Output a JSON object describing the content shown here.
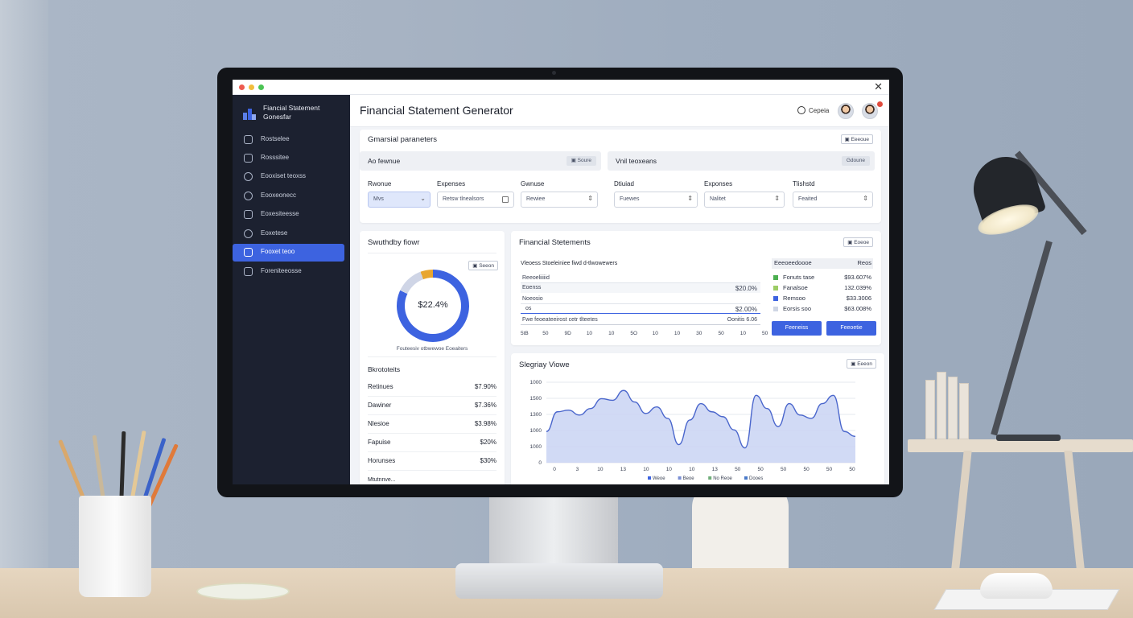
{
  "window": {
    "close_glyph": "✕"
  },
  "sidebar": {
    "brand": "Fiancial Statement Gonesfar",
    "items": [
      {
        "label": "Rostselee",
        "icon": "home-icon"
      },
      {
        "label": "Rosssitee",
        "icon": "calendar-icon"
      },
      {
        "label": "Eooxiset teoxss",
        "icon": "settings-icon"
      },
      {
        "label": "Eooxeonecc",
        "icon": "target-icon"
      },
      {
        "label": "Eoxesiteesse",
        "icon": "document-icon"
      },
      {
        "label": "Eoxetese",
        "icon": "globe-icon"
      },
      {
        "label": "Fooxet teoo",
        "icon": "user-icon",
        "active": true
      },
      {
        "label": "Foreniteeosse",
        "icon": "person-icon"
      }
    ]
  },
  "header": {
    "title": "Financial Statement Generator",
    "search_label": "Cepeia"
  },
  "params": {
    "title": "Gmarsial paraneters",
    "button": "Eeeoue",
    "left_bar": {
      "label": "Ao fewnue",
      "chip": "Soure"
    },
    "right_bar": {
      "label": "Vnil teoxeans",
      "chip": "Gdoune"
    },
    "fields": [
      {
        "label": "Rwonue",
        "value": "Mvs",
        "control": "chevron"
      },
      {
        "label": "Expenses",
        "value": "Retsw tlnealsors",
        "control": "checkbox"
      },
      {
        "label": "Gwnuse",
        "value": "Rewiee",
        "control": "stepper"
      },
      {
        "label": "Dtiuiad",
        "value": "Fuewes",
        "control": "stepper"
      },
      {
        "label": "Exponses",
        "value": "Nalitet",
        "control": "stepper"
      },
      {
        "label": "Tlishstd",
        "value": "Feaited",
        "control": "stepper"
      }
    ]
  },
  "donut_card": {
    "title": "Swuthdby fiowr",
    "button": "Seeon",
    "center_value": "$22.4%",
    "caption": "Fouteesiv otbwewoe Eoeaiters",
    "chart_data": {
      "type": "pie",
      "center_label": "$22.4%",
      "colors": [
        "#3d63e0",
        "#cfd5e6",
        "#e8a630"
      ]
    }
  },
  "breakdown": {
    "title": "Bkrototeits",
    "rows": [
      {
        "label": "Retinues",
        "value": "$7.90%"
      },
      {
        "label": "Dawiner",
        "value": "$7.36%"
      },
      {
        "label": "Nlesioe",
        "value": "$3.98%"
      },
      {
        "label": "Fapuise",
        "value": "$20%"
      },
      {
        "label": "Horunses",
        "value": "$30%"
      }
    ],
    "footer": "Mtutnnve..."
  },
  "statements": {
    "title": "Financial Stetements",
    "button": "Eoeoe",
    "table_title": "Vleoess Stoeleiniee fiwd d-tlwowewers",
    "lines": [
      {
        "label": "Reeoeliiiiid",
        "value": ""
      },
      {
        "label": "Eoenss",
        "value": "$20.0%"
      },
      {
        "label": "Noeosio",
        "value": ""
      },
      {
        "label": "os",
        "value": "$2.00%"
      },
      {
        "label": "Fwe feoeateeirost cetr tlteetes",
        "value": "Oonitis 6.06"
      }
    ],
    "axis_ticks": [
      "5tB",
      "50",
      "9D",
      "10",
      "10",
      "5O",
      "10",
      "10",
      "30",
      "50",
      "10",
      "50"
    ],
    "legend_header": {
      "name": "Eeeoeedoooe",
      "value": "Reos"
    },
    "legend": [
      {
        "name": "Fonuts tase",
        "value": "$93.607%",
        "color": "#4caf50"
      },
      {
        "name": "Fanalsoe",
        "value": "132.039%",
        "color": "#9ccc65"
      },
      {
        "name": "Remsoo",
        "value": "$33.3006",
        "color": "#3d63e0"
      },
      {
        "name": "Eorsis soo",
        "value": "$63.008%",
        "color": "#cfd6e4"
      }
    ],
    "buttons": [
      "Feeneiss",
      "Feeoetie"
    ]
  },
  "summary": {
    "title": "Slegriay Viowe",
    "button": "Eeeon",
    "chart_data": {
      "type": "area",
      "y_ticks": [
        "1000",
        "1500",
        "1300",
        "1000",
        "1000",
        "0"
      ],
      "x_ticks": [
        "0",
        "3",
        "10",
        "13",
        "10",
        "10",
        "10",
        "13",
        "50",
        "50",
        "50",
        "50",
        "50",
        "50"
      ],
      "legend": [
        "Weoe",
        "Beoe",
        "No Reoe",
        "Dooes"
      ],
      "values": [
        0.62,
        0.38,
        0.36,
        0.42,
        0.34,
        0.22,
        0.24,
        0.12,
        0.26,
        0.4,
        0.32,
        0.46,
        0.78,
        0.48,
        0.28,
        0.38,
        0.44,
        0.6,
        0.82,
        0.18,
        0.34,
        0.56,
        0.28,
        0.42,
        0.46,
        0.28,
        0.18,
        0.62,
        0.68
      ]
    }
  }
}
